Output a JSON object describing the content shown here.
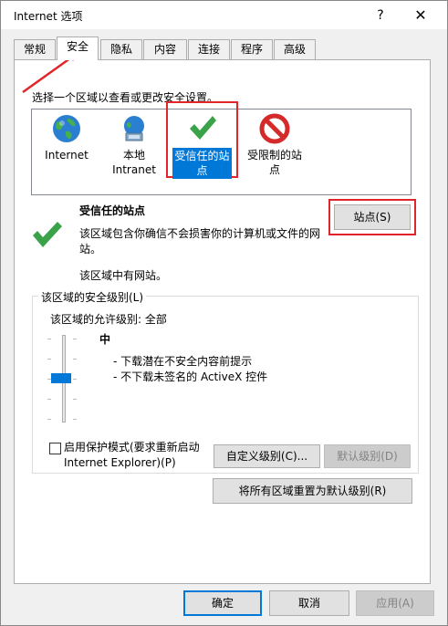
{
  "window": {
    "title": "Internet 选项"
  },
  "titlebar": {
    "help": "?",
    "close": "✕"
  },
  "tabs": [
    {
      "label": "常规",
      "active": false
    },
    {
      "label": "安全",
      "active": true
    },
    {
      "label": "隐私",
      "active": false
    },
    {
      "label": "内容",
      "active": false
    },
    {
      "label": "连接",
      "active": false
    },
    {
      "label": "程序",
      "active": false
    },
    {
      "label": "高级",
      "active": false
    }
  ],
  "security": {
    "prompt": "选择一个区域以查看或更改安全设置。",
    "zones": [
      {
        "label": "Internet",
        "icon": "globe-icon"
      },
      {
        "label": "本地\nIntranet",
        "icon": "intranet-icon"
      },
      {
        "label": "受信任的站\n点",
        "icon": "checkmark-icon",
        "selected": true
      },
      {
        "label": "受限制的站\n点",
        "icon": "restricted-icon"
      }
    ],
    "selected": {
      "title": "受信任的站点",
      "description": "该区域包含你确信不会损害你的计算机或文件的网站。",
      "note": "该区域中有网站。"
    },
    "sites_button": "站点(S)",
    "level_group": {
      "legend": "该区域的安全级别(L)",
      "allowed": "该区域的允许级别: 全部",
      "level_name": "中",
      "level_lines": [
        "- 下载潜在不安全内容前提示",
        "- 不下载未签名的 ActiveX 控件"
      ],
      "protected_mode_label": "启用保护模式(要求重新启动\nInternet Explorer)(P)",
      "protected_mode_checked": false,
      "custom_level_button": "自定义级别(C)...",
      "default_level_button": "默认级别(D)"
    },
    "reset_all_button": "将所有区域重置为默认级别(R)"
  },
  "footer": {
    "ok": "确定",
    "cancel": "取消",
    "apply": "应用(A)"
  },
  "colors": {
    "accent": "#0078d7",
    "highlight_outline": "#e0262a",
    "trusted_green": "#3aa34a",
    "restricted_red": "#d42a2a"
  }
}
